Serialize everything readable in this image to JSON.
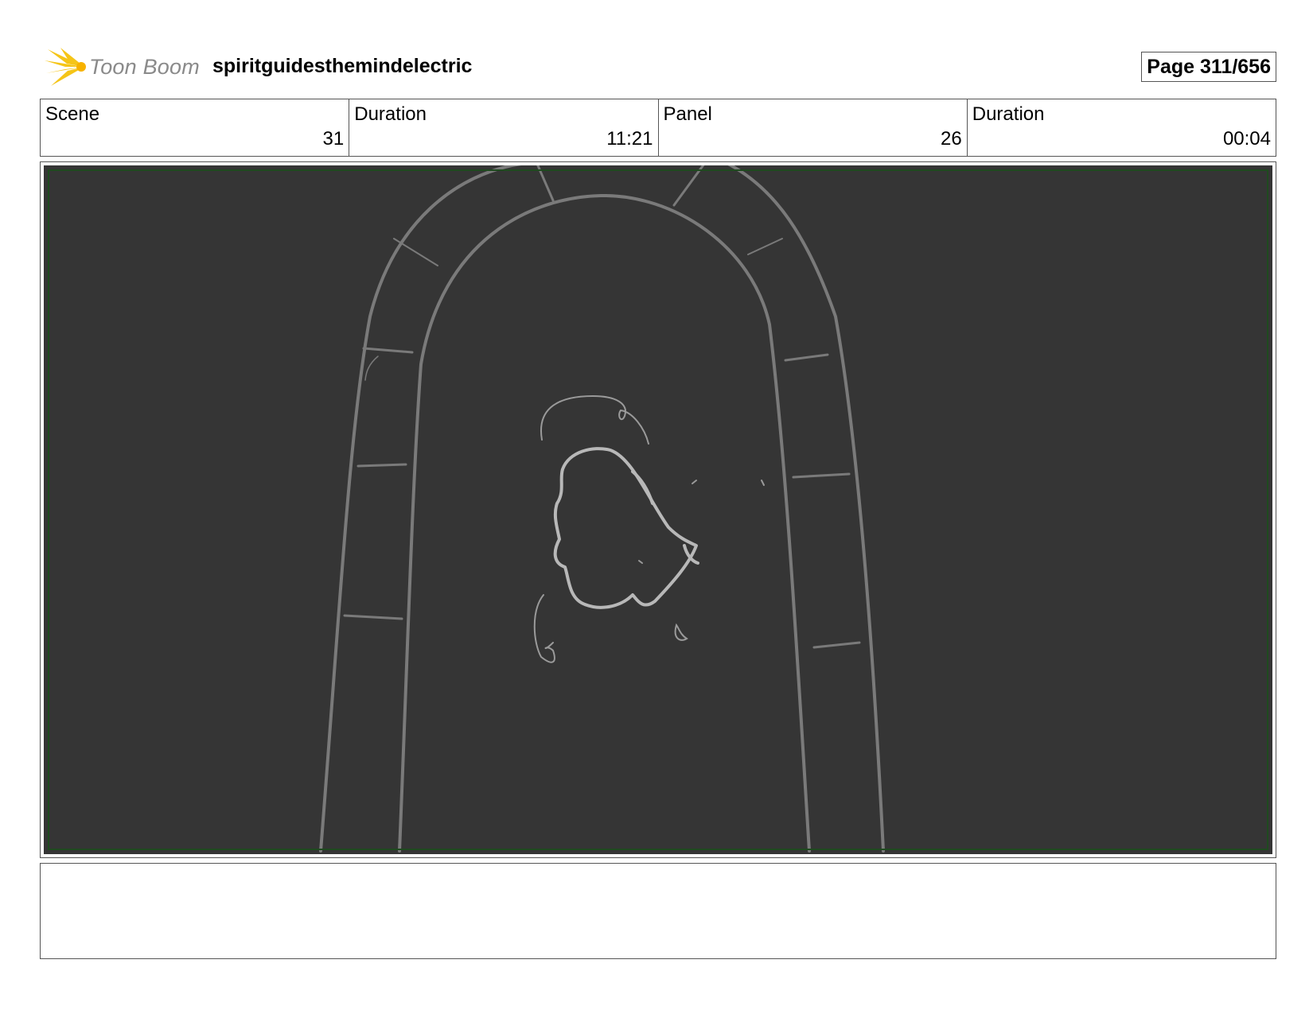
{
  "header": {
    "logo_text": "Toon Boom",
    "project_title": "spiritguidesthemindelectric",
    "page_label": "Page 311/656"
  },
  "info": [
    {
      "label": "Scene",
      "value": "31"
    },
    {
      "label": "Duration",
      "value": "11:21"
    },
    {
      "label": "Panel",
      "value": "26"
    },
    {
      "label": "Duration",
      "value": "00:04"
    }
  ],
  "panel": {
    "background_color": "#353535",
    "sketch_color": "#7a7a7a",
    "highlight_color": "#b8b8b8",
    "safe_frame_color": "#1f4a1f"
  },
  "notes": {
    "text": ""
  },
  "colors": {
    "logo_yellow": "#f5c518",
    "logo_text": "#8a8a8a",
    "border": "#555555"
  }
}
